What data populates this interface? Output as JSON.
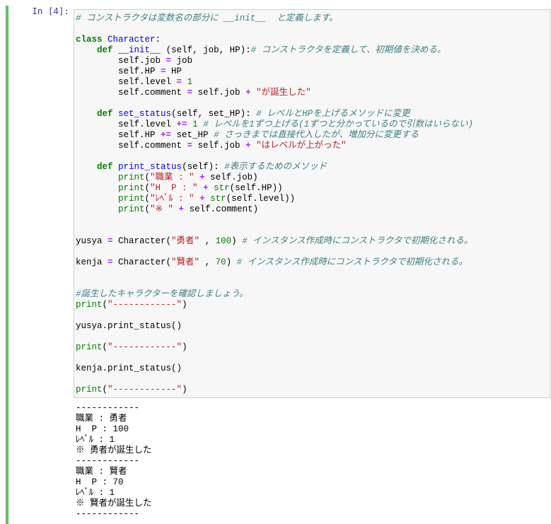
{
  "cell": {
    "prompt": "In [4]:",
    "code_lines": [
      [
        {
          "t": "cm",
          "v": "# コンストラクタは変数名の部分に __init__  と定義します。"
        }
      ],
      [],
      [
        {
          "t": "kw",
          "v": "class"
        },
        {
          "t": "",
          "v": " "
        },
        {
          "t": "fn",
          "v": "Character"
        },
        {
          "t": "",
          "v": ":"
        }
      ],
      [
        {
          "t": "",
          "v": "    "
        },
        {
          "t": "kw",
          "v": "def"
        },
        {
          "t": "",
          "v": " "
        },
        {
          "t": "fn",
          "v": "__init__"
        },
        {
          "t": "",
          "v": " (self, job, HP):"
        },
        {
          "t": "cm",
          "v": "# コンストラクタを定義して、初期値を決める。"
        }
      ],
      [
        {
          "t": "",
          "v": "        self.job "
        },
        {
          "t": "op",
          "v": "="
        },
        {
          "t": "",
          "v": " job"
        }
      ],
      [
        {
          "t": "",
          "v": "        self.HP "
        },
        {
          "t": "op",
          "v": "="
        },
        {
          "t": "",
          "v": " HP"
        }
      ],
      [
        {
          "t": "",
          "v": "        self.level "
        },
        {
          "t": "op",
          "v": "="
        },
        {
          "t": "",
          "v": " "
        },
        {
          "t": "nm",
          "v": "1"
        }
      ],
      [
        {
          "t": "",
          "v": "        self.comment "
        },
        {
          "t": "op",
          "v": "="
        },
        {
          "t": "",
          "v": " self.job "
        },
        {
          "t": "op",
          "v": "+"
        },
        {
          "t": "",
          "v": " "
        },
        {
          "t": "st",
          "v": "\"が誕生した\""
        }
      ],
      [],
      [
        {
          "t": "",
          "v": "    "
        },
        {
          "t": "kw",
          "v": "def"
        },
        {
          "t": "",
          "v": " "
        },
        {
          "t": "fn",
          "v": "set_status"
        },
        {
          "t": "",
          "v": "(self, set_HP): "
        },
        {
          "t": "cm",
          "v": "# レベルとHPを上げるメソッドに変更"
        }
      ],
      [
        {
          "t": "",
          "v": "        self.level "
        },
        {
          "t": "op",
          "v": "+="
        },
        {
          "t": "",
          "v": " "
        },
        {
          "t": "nm",
          "v": "1"
        },
        {
          "t": "",
          "v": " "
        },
        {
          "t": "cm",
          "v": "# レベルを1ずつ上げる(1ずつと分かっているので引数はいらない)"
        }
      ],
      [
        {
          "t": "",
          "v": "        self.HP "
        },
        {
          "t": "op",
          "v": "+="
        },
        {
          "t": "",
          "v": " set_HP "
        },
        {
          "t": "cm",
          "v": "# さっきまでは直接代入したが、増加分に変更する"
        }
      ],
      [
        {
          "t": "",
          "v": "        self.comment "
        },
        {
          "t": "op",
          "v": "="
        },
        {
          "t": "",
          "v": " self.job "
        },
        {
          "t": "op",
          "v": "+"
        },
        {
          "t": "",
          "v": " "
        },
        {
          "t": "st",
          "v": "\"はレベルが上がった\""
        }
      ],
      [],
      [
        {
          "t": "",
          "v": "    "
        },
        {
          "t": "kw",
          "v": "def"
        },
        {
          "t": "",
          "v": " "
        },
        {
          "t": "fn",
          "v": "print_status"
        },
        {
          "t": "",
          "v": "(self): "
        },
        {
          "t": "cm",
          "v": "#表示するためのメソッド"
        }
      ],
      [
        {
          "t": "",
          "v": "        "
        },
        {
          "t": "bi",
          "v": "print"
        },
        {
          "t": "",
          "v": "("
        },
        {
          "t": "st",
          "v": "\"職業 : \""
        },
        {
          "t": "",
          "v": " "
        },
        {
          "t": "op",
          "v": "+"
        },
        {
          "t": "",
          "v": " self.job)"
        }
      ],
      [
        {
          "t": "",
          "v": "        "
        },
        {
          "t": "bi",
          "v": "print"
        },
        {
          "t": "",
          "v": "("
        },
        {
          "t": "st",
          "v": "\"H  P : \""
        },
        {
          "t": "",
          "v": " "
        },
        {
          "t": "op",
          "v": "+"
        },
        {
          "t": "",
          "v": " "
        },
        {
          "t": "bi",
          "v": "str"
        },
        {
          "t": "",
          "v": "(self.HP))"
        }
      ],
      [
        {
          "t": "",
          "v": "        "
        },
        {
          "t": "bi",
          "v": "print"
        },
        {
          "t": "",
          "v": "("
        },
        {
          "t": "st",
          "v": "\"ﾚﾍﾞﾙ : \""
        },
        {
          "t": "",
          "v": " "
        },
        {
          "t": "op",
          "v": "+"
        },
        {
          "t": "",
          "v": " "
        },
        {
          "t": "bi",
          "v": "str"
        },
        {
          "t": "",
          "v": "(self.level))"
        }
      ],
      [
        {
          "t": "",
          "v": "        "
        },
        {
          "t": "bi",
          "v": "print"
        },
        {
          "t": "",
          "v": "("
        },
        {
          "t": "st",
          "v": "\"※ \""
        },
        {
          "t": "",
          "v": " "
        },
        {
          "t": "op",
          "v": "+"
        },
        {
          "t": "",
          "v": " self.comment)"
        }
      ],
      [],
      [],
      [
        {
          "t": "",
          "v": "yusya "
        },
        {
          "t": "op",
          "v": "="
        },
        {
          "t": "",
          "v": " Character("
        },
        {
          "t": "st",
          "v": "\"勇者\""
        },
        {
          "t": "",
          "v": " , "
        },
        {
          "t": "nm",
          "v": "100"
        },
        {
          "t": "",
          "v": ") "
        },
        {
          "t": "cm",
          "v": "# インスタンス作成時にコンストラクタで初期化される。"
        }
      ],
      [],
      [
        {
          "t": "",
          "v": "kenja "
        },
        {
          "t": "op",
          "v": "="
        },
        {
          "t": "",
          "v": " Character("
        },
        {
          "t": "st",
          "v": "\"賢者\""
        },
        {
          "t": "",
          "v": " , "
        },
        {
          "t": "nm",
          "v": "70"
        },
        {
          "t": "",
          "v": ") "
        },
        {
          "t": "cm",
          "v": "# インスタンス作成時にコンストラクタで初期化される。"
        }
      ],
      [],
      [],
      [
        {
          "t": "cm",
          "v": "#誕生したキャラクターを確認しましょう。"
        }
      ],
      [
        {
          "t": "bi",
          "v": "print"
        },
        {
          "t": "",
          "v": "("
        },
        {
          "t": "st",
          "v": "\"------------\""
        },
        {
          "t": "",
          "v": ")"
        }
      ],
      [],
      [
        {
          "t": "",
          "v": "yusya.print_status()"
        }
      ],
      [],
      [
        {
          "t": "bi",
          "v": "print"
        },
        {
          "t": "",
          "v": "("
        },
        {
          "t": "st",
          "v": "\"------------\""
        },
        {
          "t": "",
          "v": ")"
        }
      ],
      [],
      [
        {
          "t": "",
          "v": "kenja.print_status()"
        }
      ],
      [],
      [
        {
          "t": "bi",
          "v": "print"
        },
        {
          "t": "",
          "v": "("
        },
        {
          "t": "st",
          "v": "\"------------\""
        },
        {
          "t": "",
          "v": ")"
        }
      ]
    ],
    "output_lines": [
      "------------",
      "職業 : 勇者",
      "H  P : 100",
      "ﾚﾍﾞﾙ : 1",
      "※ 勇者が誕生した",
      "------------",
      "職業 : 賢者",
      "H  P : 70",
      "ﾚﾍﾞﾙ : 1",
      "※ 賢者が誕生した",
      "------------"
    ]
  },
  "colors": {
    "cell_border": "#66bb6a",
    "prompt": "#303f9f",
    "input_bg": "#f7f7f7"
  }
}
